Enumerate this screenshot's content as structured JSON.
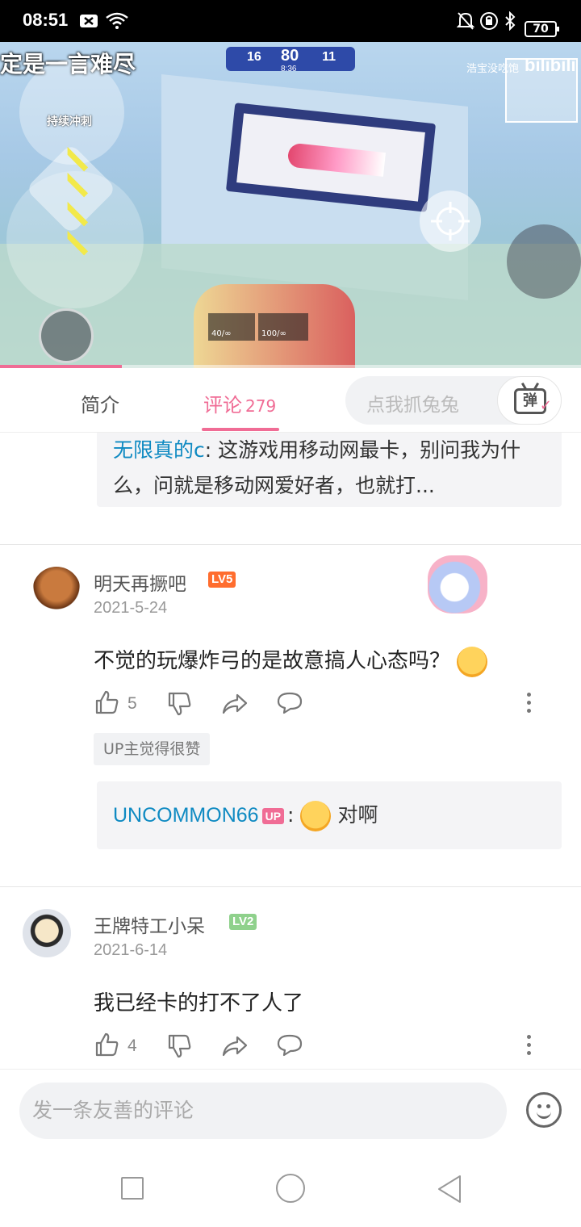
{
  "status_bar": {
    "time": "08:51",
    "battery": "70"
  },
  "video": {
    "caption": "定是一言难尽",
    "sprint_label": "持续冲刺",
    "score_left": "16",
    "score_center": "80",
    "score_right": "11",
    "timer": "8:36",
    "watermark": "浩宝没吃饱",
    "logo": "bilibili",
    "ammo_1": "40/∞",
    "ammo_2": "100/∞",
    "progress": 0.21
  },
  "tabs": {
    "intro": "简介",
    "comments": "评论",
    "comments_count": "279",
    "danmaku_placeholder": "点我抓兔兔",
    "danmaku_button": "弹"
  },
  "comments": {
    "top_reply": {
      "user": "无限真的c",
      "text": ": 这游戏用移动网最卡，别问我为什么，问就是移动网爱好者，也就打..."
    },
    "items": [
      {
        "user": "明天再撅吧",
        "level": "LV5",
        "date": "2021-5-24",
        "text": "不觉的玩爆炸弓的是故意搞人心态吗？",
        "likes": "5",
        "up_like": "UP主觉得很赞",
        "up_reply_user": "UNCOMMON66",
        "up_badge": "UP",
        "up_reply_sep": ":",
        "up_reply_text": "对啊"
      },
      {
        "user": "王牌特工小呆",
        "level": "LV2",
        "date": "2021-6-14",
        "text": "我已经卡的打不了人了",
        "likes": "4"
      }
    ]
  },
  "input_bar": {
    "placeholder": "发一条友善的评论"
  },
  "colors": {
    "accent": "#f06c95",
    "link": "#0f8ac2"
  }
}
